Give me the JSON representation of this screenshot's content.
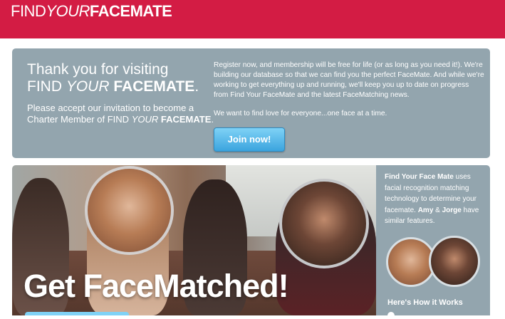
{
  "header": {
    "logo_find": "FIND",
    "logo_your": "YOUR",
    "logo_facemate": "FACEMATE",
    "color": "#d31c44"
  },
  "intro": {
    "thanks_line1": "Thank you for visiting",
    "thanks_find": "FIND",
    "thanks_your": "YOUR",
    "thanks_facemate": "FACEMATE",
    "thanks_period": ".",
    "invite_line1": "Please accept our invitation to become a",
    "invite_line2_prefix": "Charter Member of",
    "invite_find": "FIND",
    "invite_your": "YOUR",
    "invite_facemate": "FACEMATE",
    "invite_period": ".",
    "register_text": "Register now, and membership will be free for life (or as long as you need it!). We're building our database so that we can find you the perfect FaceMate. And while we're working to get everything up and running, we'll keep you up to date on progress from Find Your FaceMate and the latest FaceMatching news.",
    "love_text": "We want to find love for everyone...one face at a time.",
    "join_label": "Join now!"
  },
  "hero": {
    "headline": "Get FaceMatched!"
  },
  "side": {
    "brand": "Find Your Face Mate",
    "text1": "uses facial recognition matching technology to determine your facemate.",
    "name1": "Amy",
    "amp": "&",
    "name2": "Jorge",
    "text2": "have similar features.",
    "how_label": "Here's How it Works"
  }
}
